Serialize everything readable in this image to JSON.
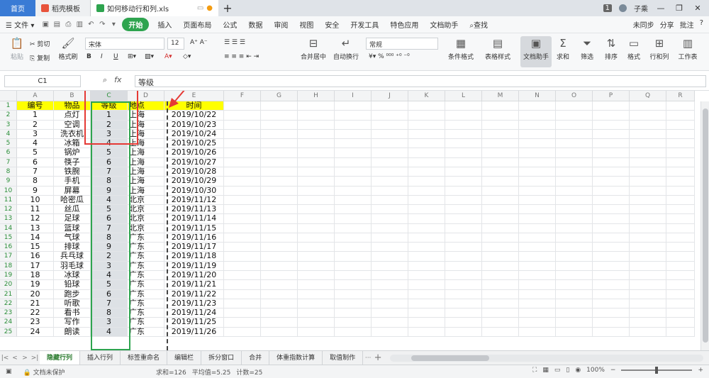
{
  "titlebar": {
    "home": "首页",
    "tab_template": "稻壳模板",
    "tab_file": "如何移动行和列.xls",
    "badge": "1",
    "user": "子乘"
  },
  "menu": {
    "file": "文件",
    "start": "开始",
    "items": [
      "插入",
      "页面布局",
      "公式",
      "数据",
      "审阅",
      "视图",
      "安全",
      "开发工具",
      "特色应用",
      "文档助手",
      "查找"
    ],
    "right": [
      "未同步",
      "分享",
      "批注",
      "?"
    ]
  },
  "ribbon": {
    "paste": "粘贴",
    "cut": "剪切",
    "copy": "复制",
    "format_painter": "格式刷",
    "font_name": "宋体",
    "font_size": "12",
    "merge": "合并居中",
    "wrap": "自动换行",
    "number_format": "常规",
    "cond_format": "条件格式",
    "table_style": "表格样式",
    "doc_helper": "文档助手",
    "sum": "求和",
    "filter": "筛选",
    "sort": "排序",
    "format": "格式",
    "rowcol": "行和列",
    "worksheet": "工作表"
  },
  "formula": {
    "namebox": "C1",
    "fx": "fx",
    "value": "等级"
  },
  "columns": [
    "A",
    "B",
    "C",
    "D",
    "E",
    "F",
    "G",
    "H",
    "I",
    "J",
    "K",
    "L",
    "M",
    "N",
    "O",
    "P",
    "Q",
    "R"
  ],
  "rows": [
    [
      "编号",
      "物品",
      "等级",
      "地点",
      "时间"
    ],
    [
      "1",
      "点灯",
      "1",
      "上海",
      "2019/10/22"
    ],
    [
      "2",
      "空调",
      "2",
      "上海",
      "2019/10/23"
    ],
    [
      "3",
      "洗衣机",
      "3",
      "上海",
      "2019/10/24"
    ],
    [
      "4",
      "冰箱",
      "4",
      "上海",
      "2019/10/25"
    ],
    [
      "5",
      "锅炉",
      "5",
      "上海",
      "2019/10/26"
    ],
    [
      "6",
      "筷子",
      "6",
      "上海",
      "2019/10/27"
    ],
    [
      "7",
      "铁腕",
      "7",
      "上海",
      "2019/10/28"
    ],
    [
      "8",
      "手机",
      "8",
      "上海",
      "2019/10/29"
    ],
    [
      "9",
      "屏幕",
      "9",
      "上海",
      "2019/10/30"
    ],
    [
      "10",
      "哈密瓜",
      "4",
      "北京",
      "2019/11/12"
    ],
    [
      "11",
      "丝瓜",
      "5",
      "北京",
      "2019/11/13"
    ],
    [
      "12",
      "足球",
      "6",
      "北京",
      "2019/11/14"
    ],
    [
      "13",
      "篮球",
      "7",
      "北京",
      "2019/11/15"
    ],
    [
      "14",
      "气球",
      "8",
      "广东",
      "2019/11/16"
    ],
    [
      "15",
      "排球",
      "9",
      "广东",
      "2019/11/17"
    ],
    [
      "16",
      "兵乓球",
      "2",
      "广东",
      "2019/11/18"
    ],
    [
      "17",
      "羽毛球",
      "3",
      "广东",
      "2019/11/19"
    ],
    [
      "18",
      "冰球",
      "4",
      "广东",
      "2019/11/20"
    ],
    [
      "19",
      "铅球",
      "5",
      "广东",
      "2019/11/21"
    ],
    [
      "20",
      "跑步",
      "6",
      "广东",
      "2019/11/22"
    ],
    [
      "21",
      "听歌",
      "7",
      "广东",
      "2019/11/23"
    ],
    [
      "22",
      "看书",
      "8",
      "广东",
      "2019/11/24"
    ],
    [
      "23",
      "写作",
      "3",
      "广东",
      "2019/11/25"
    ],
    [
      "24",
      "朗读",
      "4",
      "广东",
      "2019/11/26"
    ]
  ],
  "sheets": [
    "隐藏行列",
    "插入行列",
    "标签重命名",
    "编辑栏",
    "拆分窗口",
    "合并",
    "体重指数计算",
    "取值制作"
  ],
  "status": {
    "protect": "文档未保护",
    "sum": "求和=126",
    "avg": "平均值=5.25",
    "count": "计数=25",
    "zoom": "100%"
  },
  "colors": {
    "header_fill": "#ffff00",
    "selection_border": "#2ea44f",
    "annotation_red": "#e53935",
    "home_tab": "#3a7bd5"
  }
}
